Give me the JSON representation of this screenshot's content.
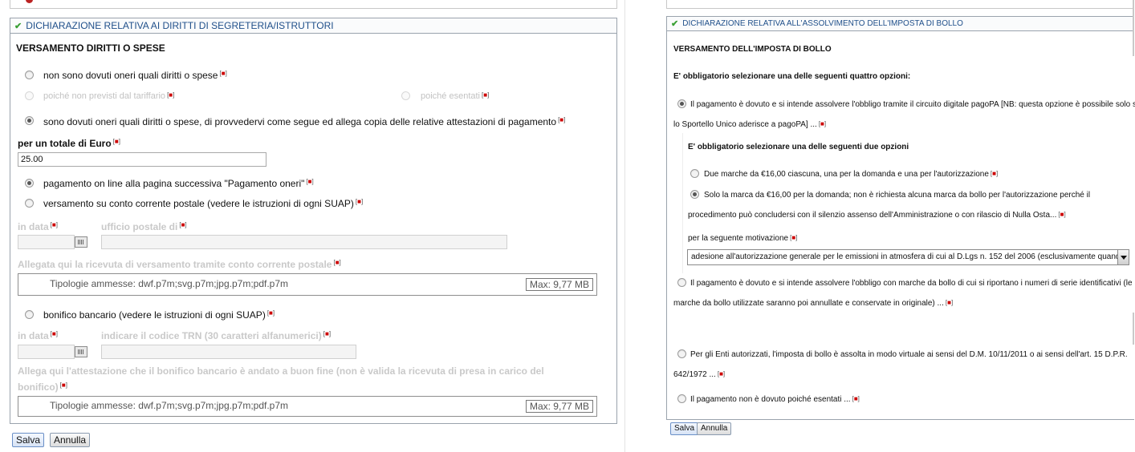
{
  "left": {
    "header": "DICHIARAZIONE RELATIVA AI DIRITTI DI SEGRETERIA/ISTRUTTORI",
    "section_title": "VERSAMENTO DIRITTI O SPESE",
    "opt_not_due": "non sono dovuti oneri quali diritti o spese",
    "sub_not_in_tariff": "poiché non previsti dal tariffario",
    "sub_exempt": "poiché esentati",
    "opt_due": "sono dovuti oneri quali diritti o spese, di provvedervi come segue ed allega copia delle relative attestazioni di pagamento",
    "total_label": "per un totale di Euro",
    "total_value": "25.00",
    "pay_online": "pagamento on line alla pagina successiva \"Pagamento oneri\"",
    "pay_postal": "versamento su conto corrente postale (vedere le istruzioni di ogni SUAP)",
    "postal_date_label": "in data",
    "postal_office_label": "ufficio postale di",
    "postal_receipt_label": "Allegata qui la ricevuta di versamento tramite conto corrente postale",
    "file_types": "Tipologie ammesse: dwf.p7m;svg.p7m;jpg.p7m;pdf.p7m",
    "file_max": "Max: 9,77 MB",
    "pay_bank": "bonifico bancario (vedere le istruzioni di ogni SUAP)",
    "bank_date_label": "in data",
    "bank_trn_label": "indicare il codice TRN (30 caratteri alfanumerici)",
    "bank_attest_line1": "Allega qui l'attestazione che il bonifico bancario è andato a buon fine (non è valida la ricevuta di presa in carico del",
    "bank_attest_line2": "bonifico)",
    "file_types_2": "Tipologie ammesse: dwf.p7m;svg.p7m;jpg.p7m;pdf.p7m",
    "file_max_2": "Max: 9,77 MB",
    "save": "Salva",
    "cancel": "Annulla"
  },
  "right": {
    "header": "DICHIARAZIONE RELATIVA ALL'ASSOLVIMENTO DELL'IMPOSTA DI BOLLO",
    "section_title": "VERSAMENTO DELL'IMPOSTA DI BOLLO",
    "mandatory_four": "E' obbligatorio selezionare una delle seguenti quattro opzioni:",
    "opt_pagopa_line1": "Il pagamento è dovuto e si intende assolvere l'obbligo tramite il circuito digitale pagoPA [NB: questa opzione è possibile solo se",
    "opt_pagopa_line2": "lo Sportello Unico aderisce a pagoPA] ...",
    "mandatory_two": "E' obbligatorio selezionare una delle seguenti due opzioni",
    "two_marks": "Due marche da €16,00 ciascuna, una per la domanda e una per l'autorizzazione",
    "one_mark_line1": "Solo la marca da €16,00 per la domanda; non è richiesta alcuna marca da bollo per l'autorizzazione perché il",
    "one_mark_line2": "procedimento può concludersi con il silenzio assenso dell'Amministrazione o con rilascio di Nulla Osta...",
    "motivation_label": "per la seguente motivazione",
    "motivation_value": "adesione all'autorizzazione generale per le emissioni in atmosfera di cui al D.Lgs n. 152 del 2006 (esclusivamente quand...",
    "opt_marks_line1": "Il pagamento è dovuto e si intende assolvere l'obbligo con marche da bollo di cui si riportano i numeri di serie identificativi (le",
    "opt_marks_line2": "marche da bollo utilizzate saranno poi annullate e conservate in originale) ...",
    "opt_virtual_line1": "Per gli Enti autorizzati, l'imposta di bollo è assolta in modo virtuale ai sensi del D.M. 10/11/2011 o ai sensi dell'art. 15 D.P.R.",
    "opt_virtual_line2": "642/1972 ...",
    "opt_exempt": "Il pagamento non è dovuto poiché esentati ...",
    "save": "Salva",
    "cancel": "Annulla"
  },
  "colors": {
    "header_text": "#1f4f8a",
    "check": "#3aa035",
    "required_mark": "#cc0000",
    "disabled_text": "#c2c2c2"
  }
}
